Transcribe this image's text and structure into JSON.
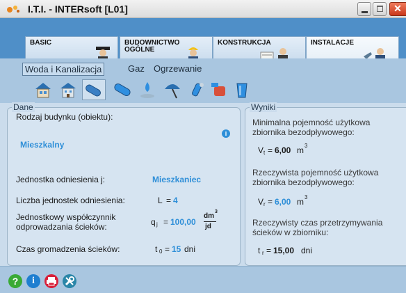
{
  "window": {
    "title": "I.T.I. - INTERsoft [L01]"
  },
  "modules": [
    {
      "label": "BASIC"
    },
    {
      "label": "BUDOWNICTWO OGÓLNE"
    },
    {
      "label": "KONSTRUKCJA"
    },
    {
      "label": "INSTALACJE"
    }
  ],
  "subtabs": [
    {
      "label": "Woda i Kanalizacja"
    },
    {
      "label": "Gaz"
    },
    {
      "label": "Ogrzewanie"
    }
  ],
  "toolbar": {
    "icons": [
      "house-icon",
      "building-icon",
      "pipe-icon",
      "pipe-icon",
      "water-drop-icon",
      "umbrella-icon",
      "fitting-icon",
      "tank-icon",
      "bucket-icon"
    ]
  },
  "dane": {
    "legend": "Dane",
    "rodzaj_label": "Rodzaj budynku (obiektu):",
    "rodzaj_value": "Mieszkalny",
    "jednostka_label": "Jednostka odniesienia j:",
    "jednostka_value": "Mieszkaniec",
    "liczba_label": "Liczba jednostek odniesienia:",
    "liczba_symbol": "L",
    "liczba_eq": "=",
    "liczba_value": "4",
    "wsp_label_line1": "Jednostkowy współczynnik",
    "wsp_label_line2": "odprowadzania ścieków:",
    "wsp_symbol": "q",
    "wsp_sub": "j",
    "wsp_eq": "=",
    "wsp_value": "100,00",
    "wsp_unit_num": "dm",
    "wsp_unit_exp": "3",
    "wsp_unit_den": "jd",
    "czas_label": "Czas gromadzenia ścieków:",
    "czas_symbol": "t",
    "czas_sub": "0",
    "czas_eq": "=",
    "czas_value": "15",
    "czas_unit": "dni"
  },
  "wyniki": {
    "legend": "Wyniki",
    "min_label_line1": "Minimalna pojemność użytkowa",
    "min_label_line2": "zbiornika bezodpływowego:",
    "min_symbol": "V",
    "min_sub": "t",
    "min_eq": "=",
    "min_value": "6,00",
    "min_unit": "m",
    "min_unit_exp": "3",
    "rz_label_line1": "Rzeczywista pojemność użytkowa",
    "rz_label_line2": "zbiornika bezodpływowego:",
    "rz_symbol": "V",
    "rz_sub": "r",
    "rz_eq": "=",
    "rz_value": "6,00",
    "rz_unit": "m",
    "rz_unit_exp": "3",
    "czas_label_line1": "Rzeczywisty czas przetrzymywania",
    "czas_label_line2": "ścieków w zbiorniku:",
    "czas_symbol": "t",
    "czas_sub": "r",
    "czas_eq": "=",
    "czas_value": "15,00",
    "czas_unit": "dni"
  },
  "bottom": {
    "help_glyph": "?",
    "info_glyph": "i"
  },
  "colors": {
    "accent_blue": "#2f8fd8",
    "help_green": "#3aaa35",
    "info_blue": "#1f7fd0",
    "print_red": "#d8203a",
    "tools_teal": "#2a86a8"
  }
}
